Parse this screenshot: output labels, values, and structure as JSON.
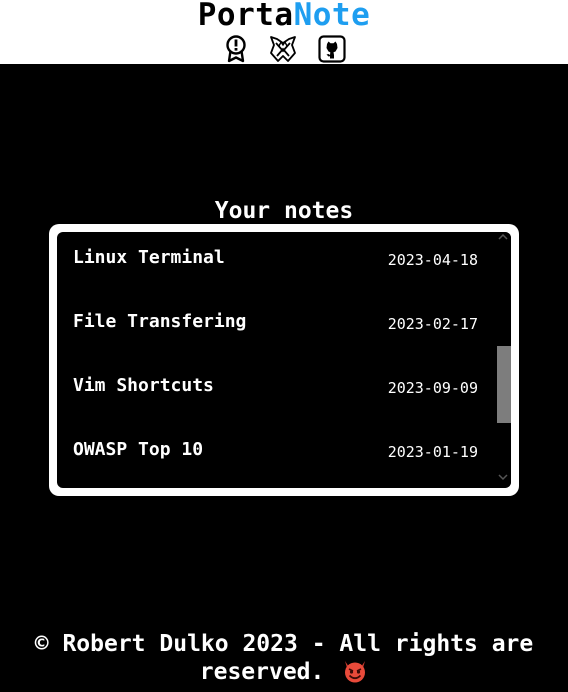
{
  "header": {
    "logo_part1": "Porta",
    "logo_part2": "Note",
    "icons": [
      {
        "name": "award-icon"
      },
      {
        "name": "league-of-legends-icon"
      },
      {
        "name": "github-icon"
      }
    ]
  },
  "main": {
    "title": "Your notes",
    "notes": [
      {
        "name": "Linux Terminal",
        "date": "2023-04-18"
      },
      {
        "name": "File Transfering",
        "date": "2023-02-17"
      },
      {
        "name": "Vim Shortcuts",
        "date": "2023-09-09"
      },
      {
        "name": "OWASP Top 10",
        "date": "2023-01-19"
      }
    ],
    "scroll_position": 0.6
  },
  "footer": {
    "text": "© Robert Dulko 2023 - All rights are reserved.",
    "emoji": "smiling-devil-emoji"
  },
  "colors": {
    "background": "#000000",
    "header_bg": "#ffffff",
    "accent": "#1e9ef0",
    "scroll_thumb": "#7d7d7d",
    "devil_purple": "#e84a3a"
  }
}
